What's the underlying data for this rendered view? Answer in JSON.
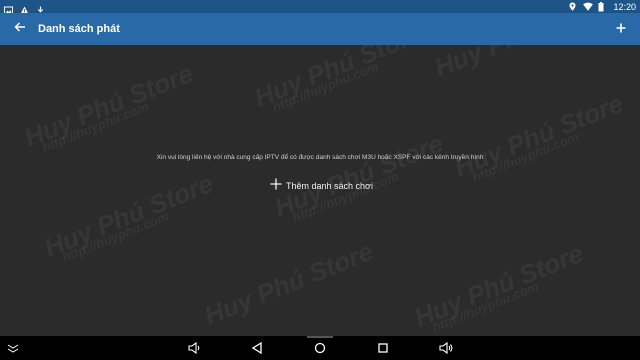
{
  "status_bar": {
    "time": "12:20",
    "left_icons": [
      "gallery-icon",
      "warning-icon",
      "download-icon"
    ],
    "right_icons": [
      "location-icon",
      "wifi-icon",
      "battery-icon"
    ]
  },
  "app_bar": {
    "title": "Danh sách phát",
    "back_icon": "arrow-left-icon",
    "add_icon": "plus-icon",
    "color": "#2a69a8"
  },
  "content": {
    "message": "Xin vui lòng liên hệ với nhà cung cấp IPTV để có được danh sách chơi M3U hoặc XSPF với các kênh truyền hình",
    "add_playlist_label": "Thêm danh sách chơi",
    "watermark_brand": "Huy Phú Store",
    "watermark_site": "http://huyphu.com"
  },
  "nav_bar": {
    "icons": [
      "hide-keyboard-icon",
      "volume-down-icon",
      "back-triangle-icon",
      "home-circle-icon",
      "recents-square-icon",
      "volume-up-icon"
    ]
  }
}
